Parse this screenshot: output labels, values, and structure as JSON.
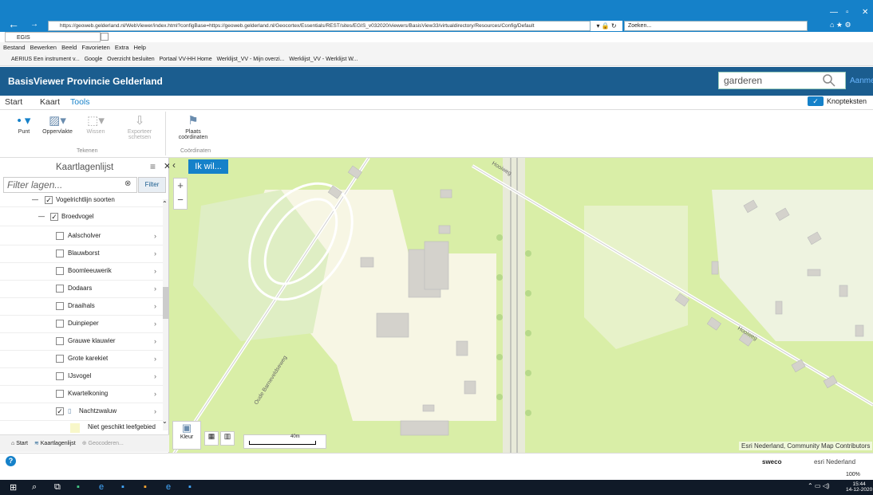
{
  "browser": {
    "url": "https://geoweb.gelderland.nl/WebViewer/index.html?configBase=https://geoweb.gelderland.nl/Geocortex/Essentials/REST/sites/EGIS_v032020/viewers/BasisView33/virtualdirectory/Resources/Config/Default",
    "search_placeholder": "Zoeken...",
    "tab_title": "EGIS",
    "menu": [
      "Bestand",
      "Bewerken",
      "Beeld",
      "Favorieten",
      "Extra",
      "Help"
    ],
    "favorites": [
      "AERIUS Een instrument v...",
      "Google",
      "Overzicht besluiten",
      "Portaal VV-HH Home",
      "Werklijst_VV - Mijn overzi...",
      "Werklijst_VV - Werklijst W..."
    ]
  },
  "app": {
    "title": "BasisViewer Provincie Gelderland",
    "search_value": "garderen",
    "account_label": "Aanmelden"
  },
  "ribbon_tabs": [
    "Start",
    "Kaart",
    "Tools"
  ],
  "knopteksten": "Knopteksten",
  "ribbon": {
    "tekenen": [
      "Punt",
      "Oppervlakte",
      "Wissen",
      "Exporteer schetsen"
    ],
    "tekenen_group": "Tekenen",
    "coord_button": "Plaats coördinaten",
    "coord_group": "Coördinaten"
  },
  "panel": {
    "title": "Kaartlagenlijst",
    "filter_placeholder": "Filter lagen...",
    "filter_button": "Filter",
    "parent1": "Vogelrichtlijn soorten",
    "parent2": "Broedvogel",
    "layers": [
      "Aalscholver",
      "Blauwborst",
      "Boomleeuwerik",
      "Dodaars",
      "Draaihals",
      "Duinpieper",
      "Grauwe klauwier",
      "Grote karekiet",
      "IJsvogel",
      "Kwartelkoning",
      "Nachtzwaluw"
    ],
    "legend_label": "Niet geschikt leefgebied",
    "bottom_tabs": [
      "Start",
      "Kaartlagenlijst",
      "Geocoderen..."
    ]
  },
  "map": {
    "ik_wil": "Ik wil...",
    "kleur": "Kleur",
    "scale": "40m",
    "attribution": "Esri Nederland, Community Map Contributors",
    "roads": [
      "Oude Barneveldseweg",
      "Hooiweg",
      "Hooiweg"
    ]
  },
  "status": {
    "sweco": "sweco",
    "esri": "esri Nederland",
    "zoom": "100%"
  },
  "taskbar": {
    "time": "15:44",
    "date": "14-12-2020"
  },
  "colors": {
    "accent": "#1581c9",
    "header": "#1b5d8f",
    "map_green": "#d9eea7"
  }
}
